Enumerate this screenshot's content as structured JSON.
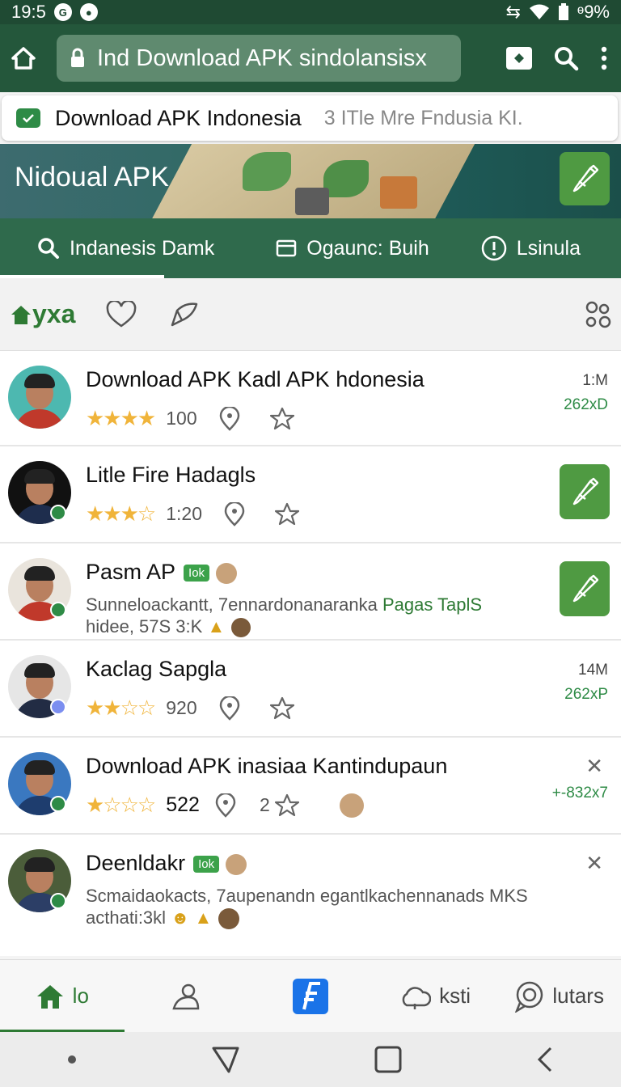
{
  "status_bar": {
    "time": "19:5",
    "badge1": "G",
    "battery": "ᶱ9%"
  },
  "browser": {
    "url": "Ind Download APK sindolansisx"
  },
  "suggestion": {
    "title": "Download APK Indonesia",
    "subtitle": "3 ITle Mre Fndusia KI."
  },
  "banner": {
    "title": "Nidoual APK"
  },
  "tabs": [
    {
      "label": "Indanesis Damk",
      "icon": "search-icon"
    },
    {
      "label": "Ogaunc: Buih",
      "icon": "window-icon"
    },
    {
      "label": "Lsinula",
      "icon": "info-icon"
    }
  ],
  "filter": {
    "brand": "yxa"
  },
  "apps": [
    {
      "title": "Download APK Kadl APK hdonesia",
      "stars": "★★★★",
      "count": "100",
      "meta1": "1:M",
      "meta2": "262xD"
    },
    {
      "title": "Litle Fire Hadagls",
      "stars": "★★★☆",
      "count": "1:20"
    },
    {
      "title": "Pasm AP",
      "chip": "Iok",
      "desc1": "Sunnelоackantt, 7ennardonanaranka ",
      "desc1_green": "Pagas TaplS",
      "desc2": "hidee, 57S 3:K"
    },
    {
      "title": "Kaclag Sapgla",
      "stars": "★★☆☆",
      "count": "920",
      "meta1": "14M",
      "meta2": "262xP"
    },
    {
      "title": "Download APK inasiaa Kantindupaun",
      "stars": "★☆☆☆",
      "count": "522",
      "extra": "2",
      "meta2": "+-832x7"
    },
    {
      "title": "Deenldakr",
      "chip": "Iok",
      "desc1": "Scmaidaokacts, 7aupenandn egantlkachennanads MKS",
      "desc2": "acthati:3kl"
    }
  ],
  "bottom_nav": [
    {
      "label": "lo",
      "icon": "home-icon"
    },
    {
      "label": "",
      "icon": "person-icon"
    },
    {
      "label": "",
      "icon": "flash-app-icon"
    },
    {
      "label": "ksti",
      "icon": "cloud-icon"
    },
    {
      "label": "lutars",
      "icon": "chat-icon"
    }
  ],
  "colors": {
    "primary": "#24573b",
    "accent": "#4f9a42",
    "star": "#f0b43a"
  }
}
